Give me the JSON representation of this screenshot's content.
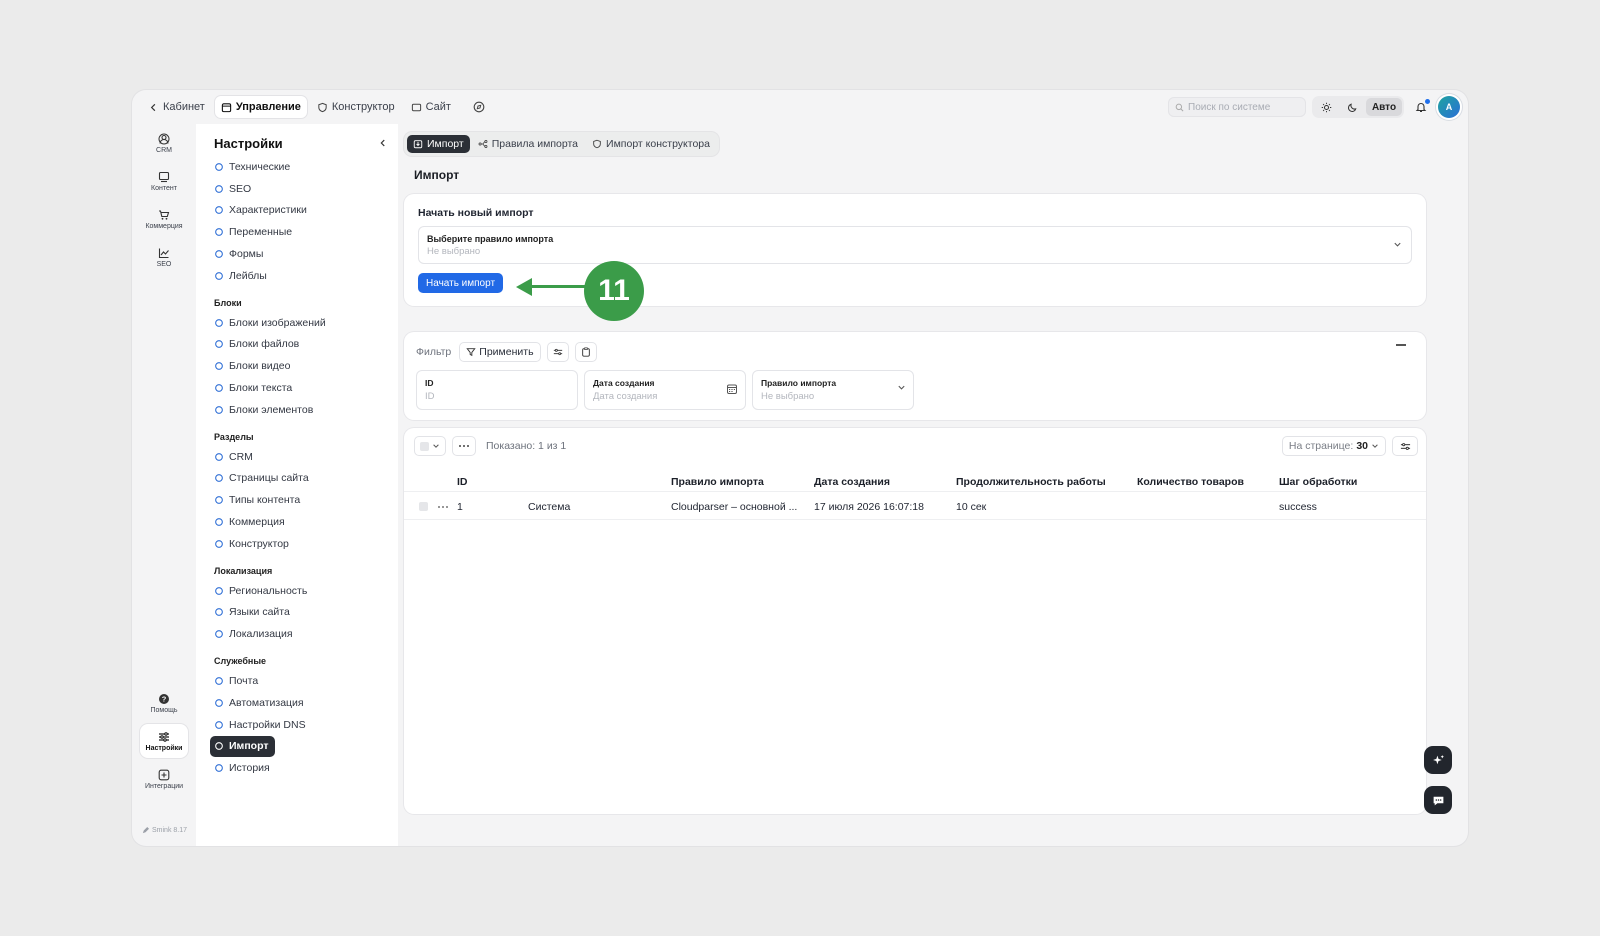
{
  "topbar": {
    "back_label": "Кабинет",
    "items": [
      {
        "label": "Управление",
        "icon": "calendar-icon",
        "active": true
      },
      {
        "label": "Конструктор",
        "icon": "shield-icon",
        "active": false
      },
      {
        "label": "Сайт",
        "icon": "monitor-icon",
        "active": false
      }
    ],
    "search_placeholder": "Поиск по системе",
    "mode_auto": "Авто",
    "avatar_letter": "A"
  },
  "rail": {
    "items": [
      {
        "label": "CRM",
        "icon": "crm-icon"
      },
      {
        "label": "Контент",
        "icon": "content-icon"
      },
      {
        "label": "Коммерция",
        "icon": "cart-icon"
      },
      {
        "label": "SEO",
        "icon": "chart-icon"
      }
    ],
    "bottom": [
      {
        "label": "Помощь",
        "icon": "help-icon"
      },
      {
        "label": "Настройки",
        "icon": "settings-icon",
        "active": true
      },
      {
        "label": "Интеграции",
        "icon": "plus-square-icon"
      }
    ],
    "version": "Smink 8.17"
  },
  "nav": {
    "title": "Настройки",
    "top_links": [
      "Технические",
      "SEO",
      "Характеристики",
      "Переменные",
      "Формы",
      "Лейблы"
    ],
    "sections": [
      {
        "title": "Блоки",
        "links": [
          "Блоки изображений",
          "Блоки файлов",
          "Блоки видео",
          "Блоки текста",
          "Блоки элементов"
        ]
      },
      {
        "title": "Разделы",
        "links": [
          "CRM",
          "Страницы сайта",
          "Типы контента",
          "Коммерция",
          "Конструктор"
        ]
      },
      {
        "title": "Локализация",
        "links": [
          "Региональность",
          "Языки сайта",
          "Локализация"
        ]
      },
      {
        "title": "Служебные",
        "links": [
          "Почта",
          "Автоматизация",
          "Настройки DNS",
          "Импорт",
          "История"
        ]
      }
    ],
    "active": "Импорт"
  },
  "main": {
    "tabs": [
      {
        "label": "Импорт",
        "active": true
      },
      {
        "label": "Правила импорта",
        "active": false
      },
      {
        "label": "Импорт конструктора",
        "active": false
      }
    ],
    "page_title": "Импорт",
    "new_import": {
      "heading": "Начать новый импорт",
      "select_label": "Выберите правило импорта",
      "select_value": "Не выбрано",
      "start_button": "Начать импорт"
    },
    "filter": {
      "label": "Фильтр",
      "apply": "Применить",
      "fields": [
        {
          "label": "ID",
          "placeholder": "ID"
        },
        {
          "label": "Дата создания",
          "placeholder": "Дата создания"
        },
        {
          "label": "Правило импорта",
          "placeholder": "Не выбрано"
        }
      ]
    },
    "table": {
      "shown": "Показано: 1 из 1",
      "per_page_label": "На странице:",
      "per_page_value": "30",
      "columns": [
        "ID",
        "",
        "Правило импорта",
        "Дата создания",
        "Продолжительность работы",
        "Количество товаров",
        "Шаг обработки"
      ],
      "rows": [
        {
          "id": "1",
          "source": "Система",
          "rule": "Cloudparser – основной ...",
          "date": "17 июля 2026 16:07:18",
          "duration": "10 сек",
          "count": "",
          "step": "success"
        }
      ]
    }
  },
  "annotation": {
    "number": "11",
    "color": "#3b9c49"
  },
  "colors": {
    "primary": "#2169e6",
    "dark": "#2b2f36",
    "accent_icon": "#2f6fd6"
  }
}
